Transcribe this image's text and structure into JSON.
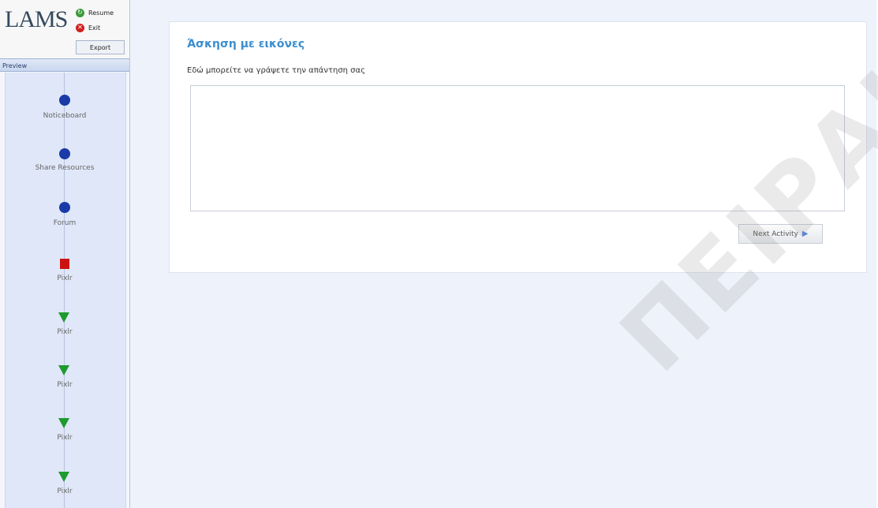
{
  "sidebar": {
    "logo": "LAMS",
    "resume_label": "Resume",
    "exit_label": "Exit",
    "export_label": "Export",
    "preview_label": "Preview",
    "activities": [
      {
        "label": "Noticeboard",
        "icon": "circle-icon"
      },
      {
        "label": "Share Resources",
        "icon": "circle-icon"
      },
      {
        "label": "Forum",
        "icon": "circle-icon"
      },
      {
        "label": "Pixlr",
        "icon": "square-icon"
      },
      {
        "label": "Pixlr",
        "icon": "triangle-icon"
      },
      {
        "label": "Pixlr",
        "icon": "triangle-icon"
      },
      {
        "label": "Pixlr",
        "icon": "triangle-icon"
      },
      {
        "label": "Pixlr",
        "icon": "triangle-icon"
      }
    ]
  },
  "main": {
    "title": "Άσκηση με εικόνες",
    "instructions": "Εδώ μπορείτε να γράψετε την απάντηση σας",
    "answer_value": "",
    "next_label": "Next Activity"
  },
  "watermark": "ΠΕΙΡΑΙΑ",
  "colors": {
    "border": "#c8202a",
    "title": "#3a8ed0",
    "circle": "#1a3aa8",
    "square": "#cc1111",
    "triangle": "#1f9a2e"
  }
}
